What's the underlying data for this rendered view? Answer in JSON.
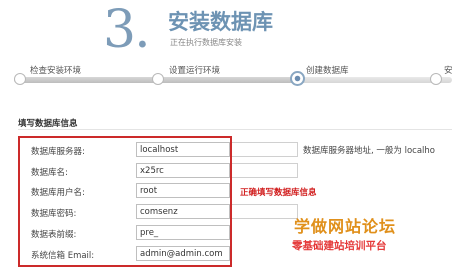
{
  "header": {
    "step_number": "3.",
    "title": "安装数据库",
    "subtitle": "正在执行数据库安装"
  },
  "steps": [
    {
      "label": "检查安装环境",
      "state": "done"
    },
    {
      "label": "设置运行环境",
      "state": "done"
    },
    {
      "label": "创建数据库",
      "state": "active"
    },
    {
      "label": "安",
      "state": "pending"
    }
  ],
  "section": {
    "title": "填写数据库信息"
  },
  "form": {
    "fields": [
      {
        "label": "数据库服务器:",
        "value": "localhost"
      },
      {
        "label": "数据库名:",
        "value": "x25rc"
      },
      {
        "label": "数据库用户名:",
        "value": "root"
      },
      {
        "label": "数据库密码:",
        "value": "comsenz"
      },
      {
        "label": "数据表前缀:",
        "value": "pre_"
      },
      {
        "label": "系统信箱 Email:",
        "value": "admin@admin.com"
      }
    ],
    "server_hint": "数据库服务器地址, 一般为 localho",
    "annotation": "正确填写数据库信息"
  },
  "watermark": {
    "line1": "学做网站论坛",
    "line2": "零基础建站培训平台"
  },
  "colors": {
    "annotation_red": "#cc2a2a",
    "title_blue": "#6d93b3"
  }
}
